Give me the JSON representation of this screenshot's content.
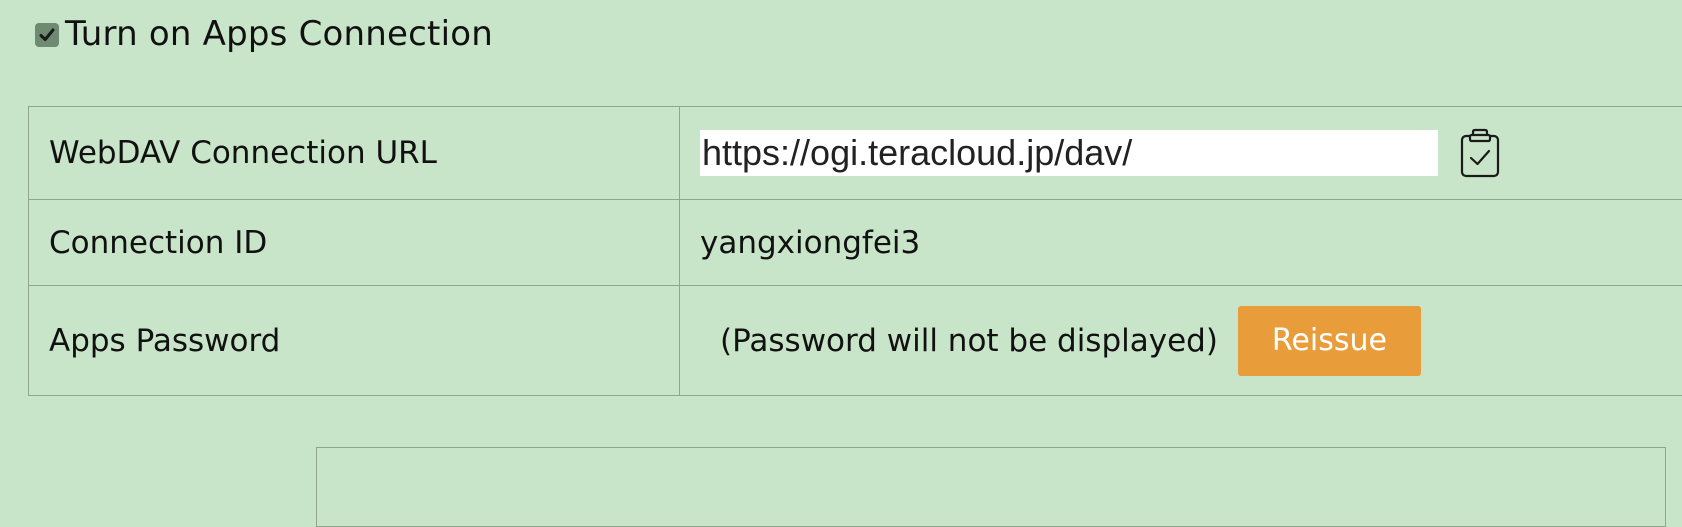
{
  "apps_connection": {
    "checkbox_checked": true,
    "label": "Turn on Apps Connection"
  },
  "settings": {
    "webdav_url": {
      "label": "WebDAV Connection URL",
      "value": "https://ogi.teracloud.jp/dav/",
      "copy_icon": "clipboard-check-icon"
    },
    "connection_id": {
      "label": "Connection ID",
      "value": "yangxiongfei3"
    },
    "apps_password": {
      "label": "Apps Password",
      "note": "(Password will not be displayed)",
      "button_label": "Reissue",
      "button_color": "#e89d3a"
    }
  },
  "colors": {
    "background": "#c9e5c9",
    "border": "#8fa58f",
    "checkbox": "#6e8a71"
  }
}
